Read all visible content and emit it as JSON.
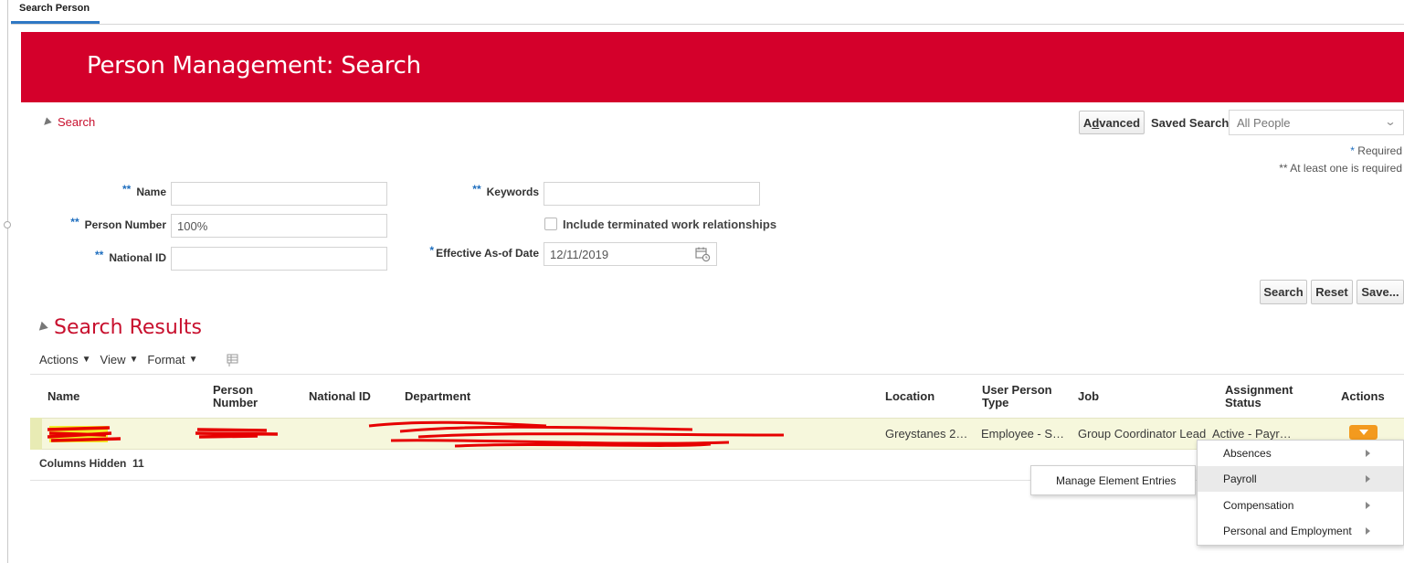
{
  "tab": {
    "label": "Search Person"
  },
  "banner": {
    "title": "Person Management: Search"
  },
  "search": {
    "toggle_label": "Search",
    "advanced_label": "Advanced",
    "advanced_access_key": "d",
    "saved_search_label": "Saved Search",
    "saved_search_value": "All People",
    "required_note_star": "*",
    "required_note": "Required",
    "at_least_one_note": "** At least one is required",
    "fields": {
      "name": {
        "stars": "**",
        "label": "Name",
        "value": ""
      },
      "person_number": {
        "stars": "**",
        "label": "Person Number",
        "value": "100%"
      },
      "national_id": {
        "stars": "**",
        "label": "National ID",
        "value": ""
      },
      "keywords": {
        "stars": "**",
        "label": "Keywords",
        "value": ""
      },
      "include_terminated": {
        "label": "Include terminated work relationships",
        "checked": false
      },
      "effective_date": {
        "stars": "*",
        "label": "Effective As-of Date",
        "value": "12/11/2019"
      }
    },
    "buttons": {
      "search": "Search",
      "reset": "Reset",
      "save": "Save..."
    }
  },
  "results": {
    "title": "Search Results",
    "toolbar": {
      "actions": "Actions",
      "view": "View",
      "format": "Format"
    },
    "columns": {
      "name": "Name",
      "person_number_1": "Person",
      "person_number_2": "Number",
      "national_id": "National ID",
      "department": "Department",
      "location": "Location",
      "user_person_type_1": "User Person",
      "user_person_type_2": "Type",
      "job": "Job",
      "assignment_status_1": "Assignment",
      "assignment_status_2": "Status",
      "actions": "Actions"
    },
    "row": {
      "location": "Greystanes 2…",
      "user_person_type": "Employee - S…",
      "job": "Group Coordinator Lead",
      "assignment_status": "Active - Payr…"
    },
    "columns_hidden_label": "Columns Hidden",
    "columns_hidden_count": "11"
  },
  "actions_menu": {
    "items": [
      "Absences",
      "Payroll",
      "Compensation",
      "Personal and Employment"
    ],
    "highlighted": "Payroll",
    "submenu_item": "Manage Element Entries"
  },
  "colors": {
    "banner": "#d4002b",
    "accent_red": "#c8102e",
    "required_star": "#1f6fbf",
    "row_highlight": "#f6f7dc",
    "actions_button": "#f39a1e"
  },
  "icons": {
    "calendar": "calendar-icon",
    "freeze": "freeze-column-icon",
    "submenu_arrow": "submenu-arrow-icon"
  }
}
